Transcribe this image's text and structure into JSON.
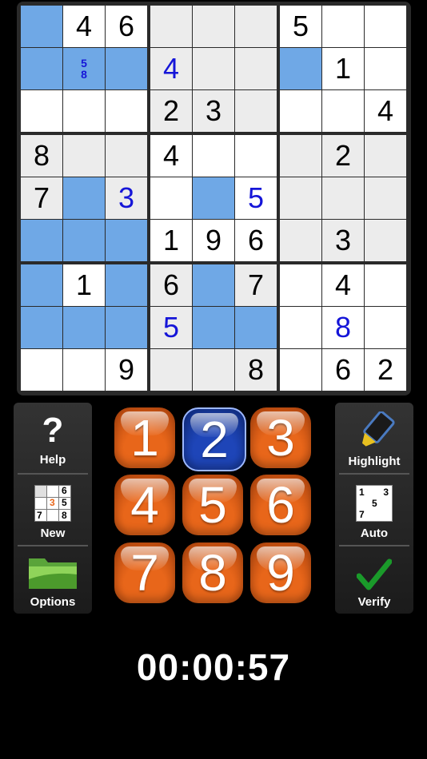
{
  "board": {
    "cells": [
      [
        "",
        "4",
        "6",
        "",
        "",
        "",
        "5",
        "",
        ""
      ],
      [
        "",
        "",
        "",
        "4",
        "",
        "",
        "",
        "1",
        ""
      ],
      [
        "",
        "",
        "",
        "2",
        "3",
        "",
        "",
        "",
        "4"
      ],
      [
        "8",
        "",
        "",
        "4",
        "",
        "",
        "",
        "2",
        ""
      ],
      [
        "7",
        "",
        "3",
        "",
        "",
        "5",
        "",
        "",
        ""
      ],
      [
        "",
        "",
        "",
        "1",
        "9",
        "6",
        "",
        "3",
        ""
      ],
      [
        "",
        "1",
        "",
        "6",
        "",
        "7",
        "",
        "4",
        ""
      ],
      [
        "",
        "",
        "",
        "5",
        "",
        "",
        "",
        "8",
        ""
      ],
      [
        "",
        "",
        "9",
        "",
        "",
        "8",
        "",
        "6",
        "2"
      ]
    ],
    "user_entries": [
      [
        1,
        3
      ],
      [
        4,
        2
      ],
      [
        4,
        5
      ],
      [
        7,
        3
      ],
      [
        7,
        7
      ]
    ],
    "highlighted": [
      [
        0,
        0
      ],
      [
        1,
        0
      ],
      [
        1,
        1
      ],
      [
        1,
        2
      ],
      [
        1,
        6
      ],
      [
        4,
        1
      ],
      [
        4,
        4
      ],
      [
        5,
        0
      ],
      [
        5,
        1
      ],
      [
        5,
        2
      ],
      [
        6,
        0
      ],
      [
        6,
        2
      ],
      [
        6,
        4
      ],
      [
        7,
        0
      ],
      [
        7,
        1
      ],
      [
        7,
        2
      ],
      [
        7,
        4
      ],
      [
        7,
        5
      ]
    ],
    "notes": [
      {
        "row": 1,
        "col": 1,
        "values": [
          "5",
          "8"
        ]
      }
    ]
  },
  "number_pad": {
    "buttons": [
      "1",
      "2",
      "3",
      "4",
      "5",
      "6",
      "7",
      "8",
      "9"
    ],
    "selected": "2",
    "colors": {
      "normal": "#e8661a",
      "selected": "#1e45b8"
    }
  },
  "left_panel": {
    "help_label": "Help",
    "help_symbol": "?",
    "new_label": "New",
    "options_label": "Options",
    "new_icon_digits": [
      "6",
      "3",
      "5",
      "7",
      "8"
    ]
  },
  "right_panel": {
    "highlight_label": "Highlight",
    "auto_label": "Auto",
    "verify_label": "Verify",
    "auto_icon_digits": [
      "1",
      "3",
      "5",
      "7"
    ]
  },
  "timer": "00:00:57",
  "colors": {
    "highlight": "#6fa8e6",
    "user_digit": "#1515d8",
    "check": "#1a9a2a"
  }
}
